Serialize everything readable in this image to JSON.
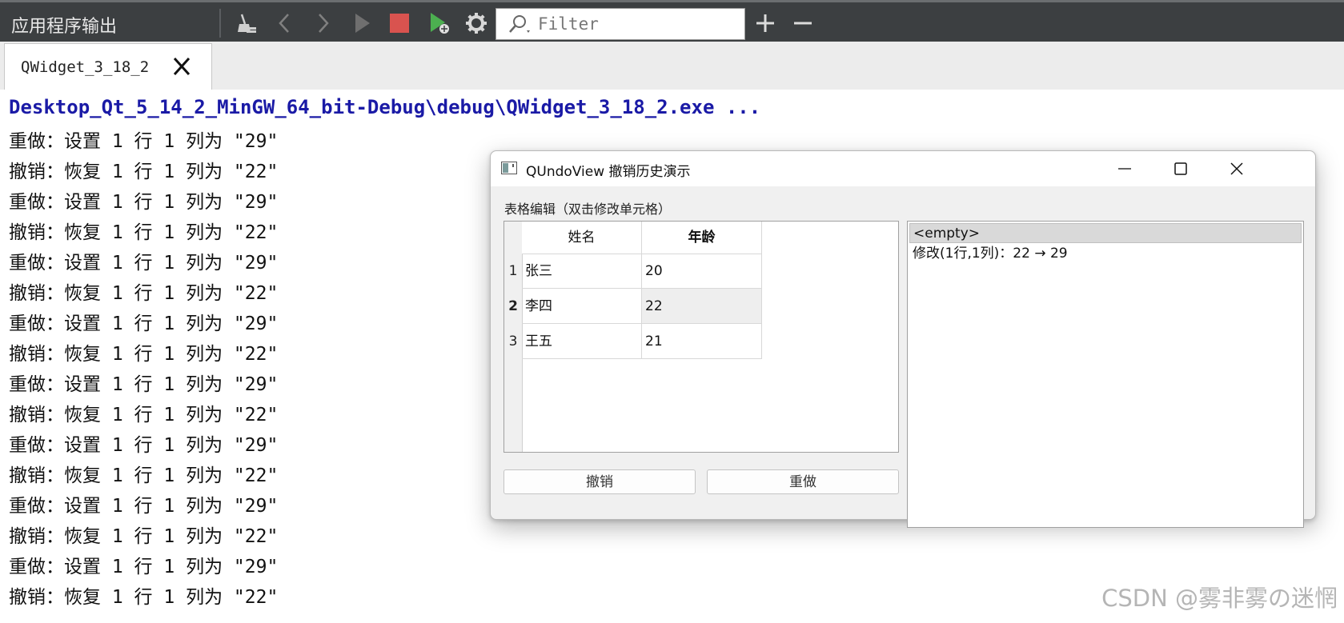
{
  "toolbar": {
    "title": "应用程序输出",
    "filter_placeholder": "Filter"
  },
  "tab": {
    "label": "QWidget_3_18_2"
  },
  "console": {
    "path_line": "Desktop_Qt_5_14_2_MinGW_64_bit-Debug\\debug\\QWidget_3_18_2.exe ...",
    "lines": [
      "重做：设置 1 行 1 列为 \"29\"",
      "撤销：恢复 1 行 1 列为 \"22\"",
      "重做：设置 1 行 1 列为 \"29\"",
      "撤销：恢复 1 行 1 列为 \"22\"",
      "重做：设置 1 行 1 列为 \"29\"",
      "撤销：恢复 1 行 1 列为 \"22\"",
      "重做：设置 1 行 1 列为 \"29\"",
      "撤销：恢复 1 行 1 列为 \"22\"",
      "重做：设置 1 行 1 列为 \"29\"",
      "撤销：恢复 1 行 1 列为 \"22\"",
      "重做：设置 1 行 1 列为 \"29\"",
      "撤销：恢复 1 行 1 列为 \"22\"",
      "重做：设置 1 行 1 列为 \"29\"",
      "撤销：恢复 1 行 1 列为 \"22\"",
      "重做：设置 1 行 1 列为 \"29\"",
      "撤销：恢复 1 行 1 列为 \"22\""
    ]
  },
  "dialog": {
    "title": "QUndoView 撤销历史演示",
    "group_label": "表格编辑（双击修改单元格）",
    "table": {
      "headers": [
        "姓名",
        "年龄"
      ],
      "rows": [
        {
          "num": "1",
          "name": "张三",
          "age": "20"
        },
        {
          "num": "2",
          "name": "李四",
          "age": "22"
        },
        {
          "num": "3",
          "name": "王五",
          "age": "21"
        }
      ]
    },
    "undo_button": "撤销",
    "redo_button": "重做",
    "undo_view": {
      "items": [
        "<empty>",
        "修改(1行,1列)：22 → 29"
      ]
    }
  },
  "watermark": "CSDN @雾非雾の迷惘",
  "colors": {
    "toolbar_bg": "#3c3f41",
    "path_text": "#1a1aa6",
    "stop_red": "#d9534f",
    "run_green": "#4caf50"
  }
}
